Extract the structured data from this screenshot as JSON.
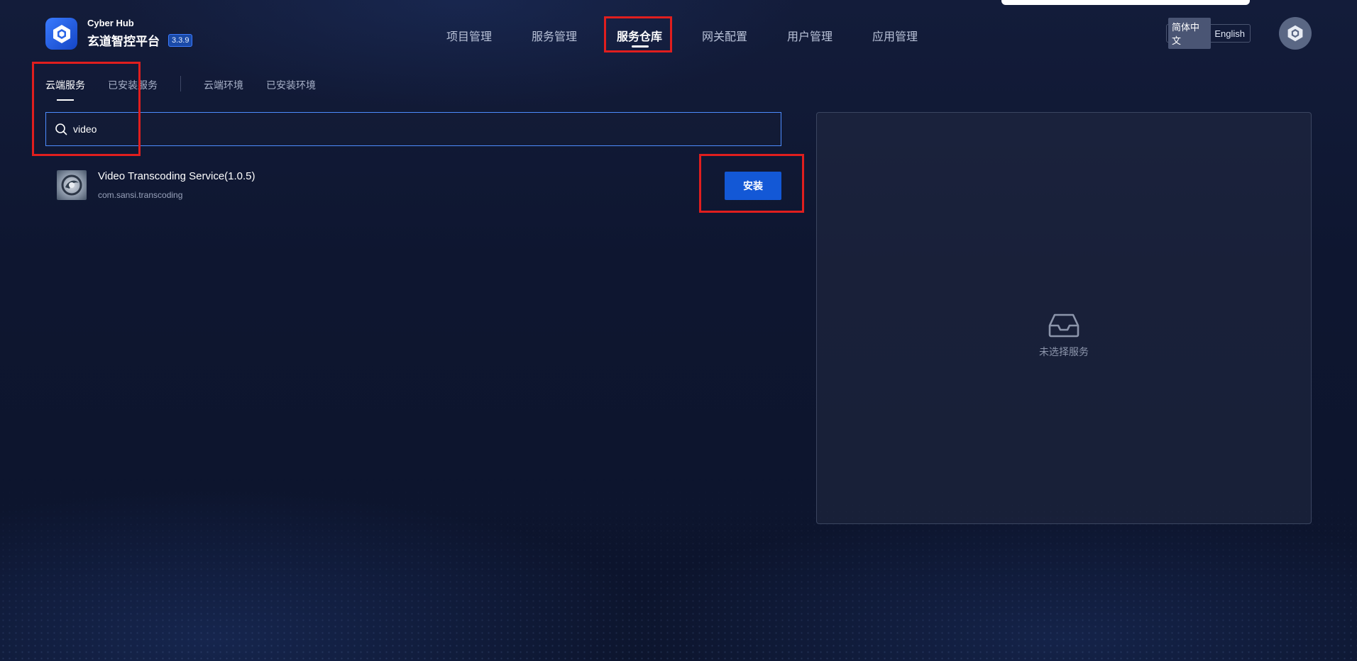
{
  "header": {
    "brand_en": "Cyber Hub",
    "brand_cn": "玄道智控平台",
    "version": "3.3.9",
    "nav": [
      {
        "label": "项目管理",
        "active": false
      },
      {
        "label": "服务管理",
        "active": false
      },
      {
        "label": "服务仓库",
        "active": true
      },
      {
        "label": "网关配置",
        "active": false
      },
      {
        "label": "用户管理",
        "active": false
      },
      {
        "label": "应用管理",
        "active": false
      }
    ],
    "lang": {
      "zh": "简体中文",
      "en": "English",
      "active": "简体中文"
    }
  },
  "subtabs": [
    {
      "label": "云端服务",
      "active": true
    },
    {
      "label": "已安装服务",
      "active": false
    },
    {
      "label": "云端环境",
      "active": false
    },
    {
      "label": "已安装环境",
      "active": false
    }
  ],
  "search": {
    "value": "video"
  },
  "results": [
    {
      "title": "Video Transcoding Service(1.0.5)",
      "package": "com.sansi.transcoding",
      "action_label": "安装"
    }
  ],
  "detail": {
    "empty_text": "未选择服务"
  },
  "colors": {
    "accent": "#1358d6",
    "annotation": "#e01e1e",
    "background": "#0e1630"
  },
  "icons": [
    "search-icon",
    "inbox-icon",
    "hexagon-logo-icon"
  ]
}
